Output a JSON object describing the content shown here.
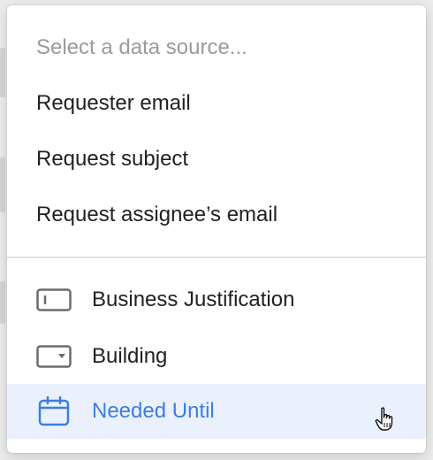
{
  "dropdown": {
    "placeholder": "Select a data source...",
    "options": [
      {
        "label": "Requester email"
      },
      {
        "label": "Request subject"
      },
      {
        "label": "Request assignee’s email"
      }
    ],
    "fields": [
      {
        "label": "Business Justification",
        "icon": "text-field-icon"
      },
      {
        "label": "Building",
        "icon": "dropdown-field-icon"
      },
      {
        "label": "Needed Until",
        "icon": "calendar-icon",
        "highlighted": true
      }
    ]
  },
  "colors": {
    "highlight_bg": "#eaf1fd",
    "highlight_text": "#3d7de0",
    "icon_gray": "#6b6b70",
    "placeholder": "#9a9a9f"
  }
}
